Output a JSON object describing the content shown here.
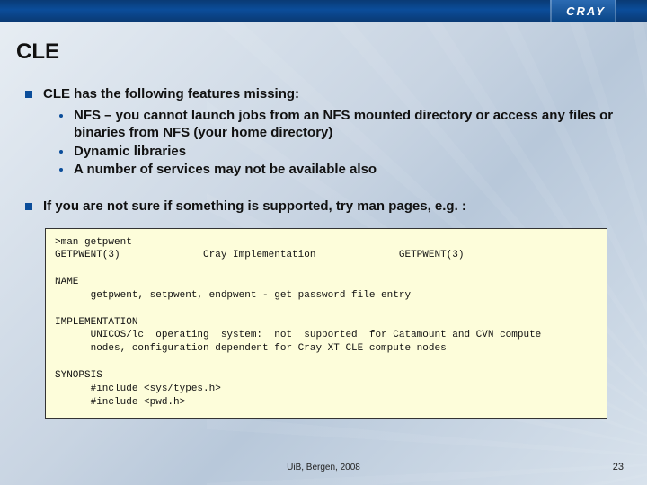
{
  "brand": "CRAY",
  "title": "CLE",
  "bullets": [
    {
      "text": "CLE has the following features missing:",
      "subs": [
        "NFS – you cannot launch jobs from an NFS mounted directory or access any files or binaries from NFS (your home directory)",
        "Dynamic libraries",
        "A number of services may not be available also"
      ]
    },
    {
      "text": "If you are not sure if something is supported, try man pages, e.g. :",
      "subs": []
    }
  ],
  "code": ">man getpwent\nGETPWENT(3)              Cray Implementation              GETPWENT(3)\n\nNAME\n      getpwent, setpwent, endpwent - get password file entry\n\nIMPLEMENTATION\n      UNICOS/lc  operating  system:  not  supported  for Catamount and CVN compute\n      nodes, configuration dependent for Cray XT CLE compute nodes\n\nSYNOPSIS\n      #include <sys/types.h>\n      #include <pwd.h>",
  "footer": {
    "center": "UiB, Bergen, 2008",
    "page": "23"
  }
}
